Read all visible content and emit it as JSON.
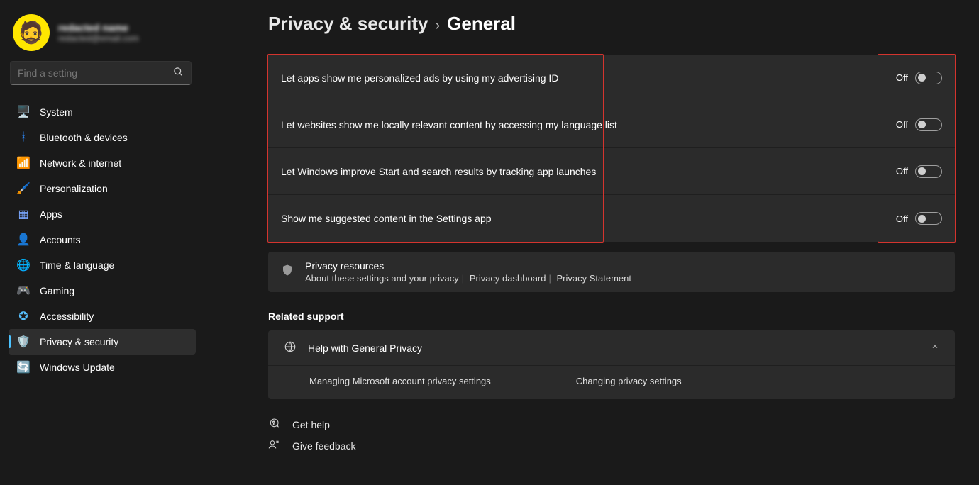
{
  "profile": {
    "name": "redacted name",
    "email": "redacted@email.com"
  },
  "search": {
    "placeholder": "Find a setting"
  },
  "sidebar": {
    "items": [
      {
        "icon": "🖥️",
        "label": "System"
      },
      {
        "icon": "ᚼ",
        "label": "Bluetooth & devices",
        "iconColor": "#2f8cff"
      },
      {
        "icon": "📶",
        "label": "Network & internet"
      },
      {
        "icon": "🖌️",
        "label": "Personalization"
      },
      {
        "icon": "▦",
        "label": "Apps",
        "iconColor": "#7aa7ff"
      },
      {
        "icon": "👤",
        "label": "Accounts"
      },
      {
        "icon": "🌐",
        "label": "Time & language"
      },
      {
        "icon": "🎮",
        "label": "Gaming"
      },
      {
        "icon": "✪",
        "label": "Accessibility",
        "iconColor": "#57c1ff"
      },
      {
        "icon": "🛡️",
        "label": "Privacy & security"
      },
      {
        "icon": "🔄",
        "label": "Windows Update",
        "iconColor": "#2f8cff"
      }
    ],
    "activeIndex": 9
  },
  "breadcrumb": {
    "parent": "Privacy & security",
    "current": "General"
  },
  "toggles": [
    {
      "label": "Let apps show me personalized ads by using my advertising ID",
      "state": "Off"
    },
    {
      "label": "Let websites show me locally relevant content by accessing my language list",
      "state": "Off"
    },
    {
      "label": "Let Windows improve Start and search results by tracking app launches",
      "state": "Off"
    },
    {
      "label": "Show me suggested content in the Settings app",
      "state": "Off"
    }
  ],
  "resources": {
    "title": "Privacy resources",
    "links": [
      "About these settings and your privacy",
      "Privacy dashboard",
      "Privacy Statement"
    ]
  },
  "related": {
    "heading": "Related support",
    "help_title": "Help with General Privacy",
    "sub": [
      "Managing Microsoft account privacy settings",
      "Changing privacy settings"
    ]
  },
  "footer": {
    "help": "Get help",
    "feedback": "Give feedback"
  }
}
